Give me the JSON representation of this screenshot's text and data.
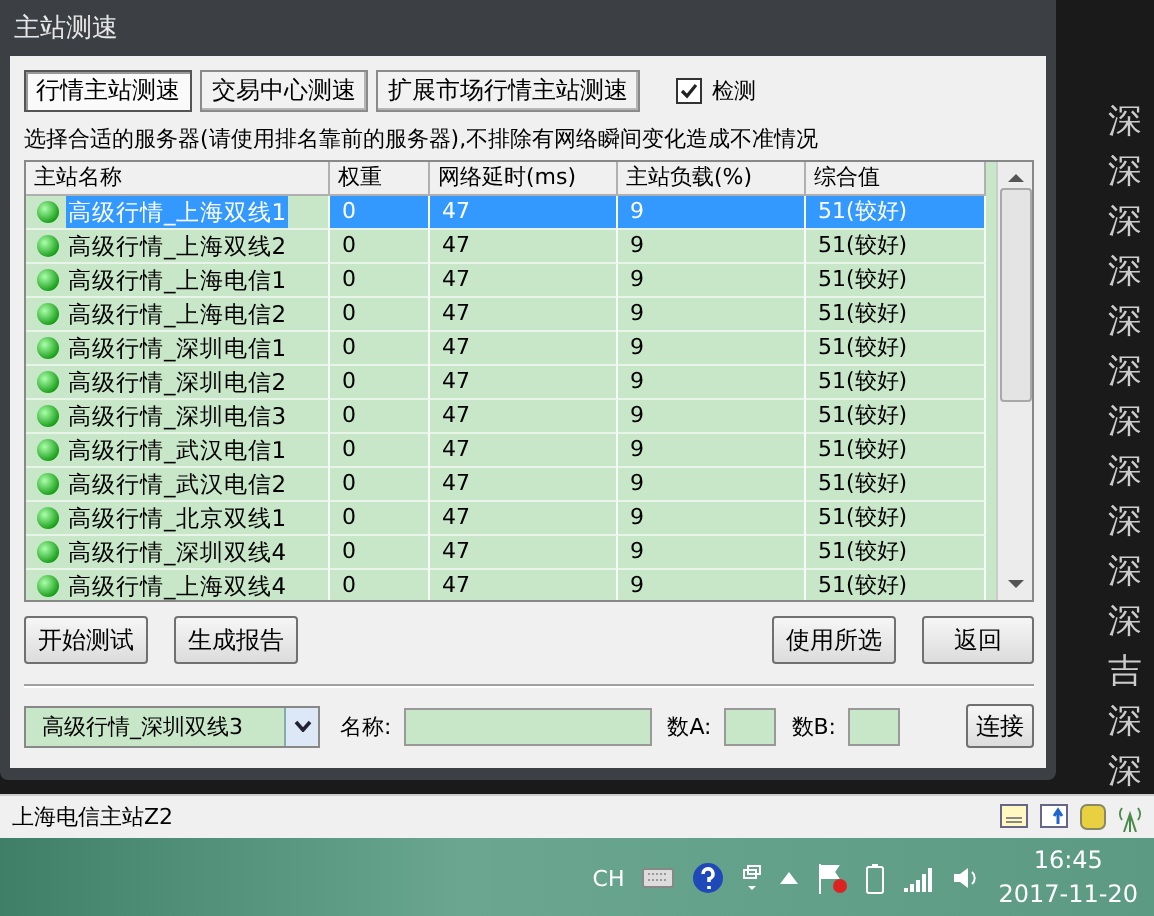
{
  "window": {
    "title": "主站测速"
  },
  "tabs": [
    {
      "label": "行情主站测速",
      "selected": true
    },
    {
      "label": "交易中心测速",
      "selected": false
    },
    {
      "label": "扩展市场行情主站测速",
      "selected": false
    }
  ],
  "detect_checkbox": {
    "label": "检测",
    "checked": true
  },
  "hint": "选择合适的服务器(请使用排名靠前的服务器),不排除有网络瞬间变化造成不准情况",
  "table": {
    "columns": [
      "主站名称",
      "权重",
      "网络延时(ms)",
      "主站负载(%)",
      "综合值"
    ],
    "rows": [
      {
        "cells": [
          "高级行情_上海双线1",
          "0",
          "47",
          "9",
          "51(较好)"
        ],
        "selected": true
      },
      {
        "cells": [
          "高级行情_上海双线2",
          "0",
          "47",
          "9",
          "51(较好)"
        ],
        "selected": false
      },
      {
        "cells": [
          "高级行情_上海电信1",
          "0",
          "47",
          "9",
          "51(较好)"
        ],
        "selected": false
      },
      {
        "cells": [
          "高级行情_上海电信2",
          "0",
          "47",
          "9",
          "51(较好)"
        ],
        "selected": false
      },
      {
        "cells": [
          "高级行情_深圳电信1",
          "0",
          "47",
          "9",
          "51(较好)"
        ],
        "selected": false
      },
      {
        "cells": [
          "高级行情_深圳电信2",
          "0",
          "47",
          "9",
          "51(较好)"
        ],
        "selected": false
      },
      {
        "cells": [
          "高级行情_深圳电信3",
          "0",
          "47",
          "9",
          "51(较好)"
        ],
        "selected": false
      },
      {
        "cells": [
          "高级行情_武汉电信1",
          "0",
          "47",
          "9",
          "51(较好)"
        ],
        "selected": false
      },
      {
        "cells": [
          "高级行情_武汉电信2",
          "0",
          "47",
          "9",
          "51(较好)"
        ],
        "selected": false
      },
      {
        "cells": [
          "高级行情_北京双线1",
          "0",
          "47",
          "9",
          "51(较好)"
        ],
        "selected": false
      },
      {
        "cells": [
          "高级行情_深圳双线4",
          "0",
          "47",
          "9",
          "51(较好)"
        ],
        "selected": false
      },
      {
        "cells": [
          "高级行情_上海双线4",
          "0",
          "47",
          "9",
          "51(较好)"
        ],
        "selected": false
      }
    ]
  },
  "buttons_left": [
    "开始测试",
    "生成报告"
  ],
  "buttons_right": [
    "使用所选",
    "返回"
  ],
  "server_select": {
    "value": "高级行情_深圳双线3"
  },
  "name_field": {
    "label": "名称:"
  },
  "num_a_field": {
    "label": "数A:"
  },
  "num_b_field": {
    "label": "数B:"
  },
  "connect_button": "连接",
  "background_column": [
    "深",
    "深",
    "深",
    "深",
    "深",
    "深",
    "深",
    "深",
    "深",
    "深",
    "深",
    "吉",
    "深",
    "深"
  ],
  "status_bar": "上海电信主站Z2",
  "taskbar": {
    "language": "CH",
    "time": "16:45",
    "date": "2017-11-20"
  }
}
